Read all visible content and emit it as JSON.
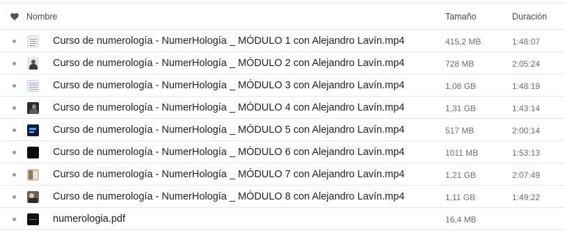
{
  "header": {
    "favorite_icon": "heart-icon",
    "name_label": "Nombre",
    "size_label": "Tamaño",
    "duration_label": "Duración"
  },
  "files": [
    {
      "name": "Curso de numerología - NumerHología _ MÓDULO 1 con Alejandro Lavín.mp4",
      "size": "415,2 MB",
      "duration": "1:48:07",
      "thumb": "doc"
    },
    {
      "name": "Curso de numerología - NumerHología _ MÓDULO 2 con Alejandro Lavín.mp4",
      "size": "728 MB",
      "duration": "2:05:24",
      "thumb": "person"
    },
    {
      "name": "Curso de numerología - NumerHología _ MÓDULO 3 con Alejandro Lavín.mp4",
      "size": "1,08 GB",
      "duration": "1:48:19",
      "thumb": "sheet"
    },
    {
      "name": "Curso de numerología - NumerHología _ MÓDULO 4 con Alejandro Lavín.mp4",
      "size": "1,31 GB",
      "duration": "1:43:14",
      "thumb": "dark"
    },
    {
      "name": "Curso de numerología - NumerHología _ MÓDULO 5 con Alejandro Lavín.mp4",
      "size": "517 MB",
      "duration": "2:00:14",
      "thumb": "screen"
    },
    {
      "name": "Curso de numerología - NumerHología _ MÓDULO 6 con Alejandro Lavín.mp4",
      "size": "1011 MB",
      "duration": "1:53:13",
      "thumb": "black"
    },
    {
      "name": "Curso de numerología - NumerHología _ MÓDULO 7 con Alejandro Lavín.mp4",
      "size": "1,21 GB",
      "duration": "2:07:49",
      "thumb": "photo"
    },
    {
      "name": "Curso de numerología - NumerHología _ MÓDULO 8 con Alejandro Lavín.mp4",
      "size": "1,11 GB",
      "duration": "1:49:22",
      "thumb": "photo2"
    },
    {
      "name": "numerologia.pdf",
      "size": "16,4 MB",
      "duration": "",
      "thumb": "pdf"
    }
  ]
}
